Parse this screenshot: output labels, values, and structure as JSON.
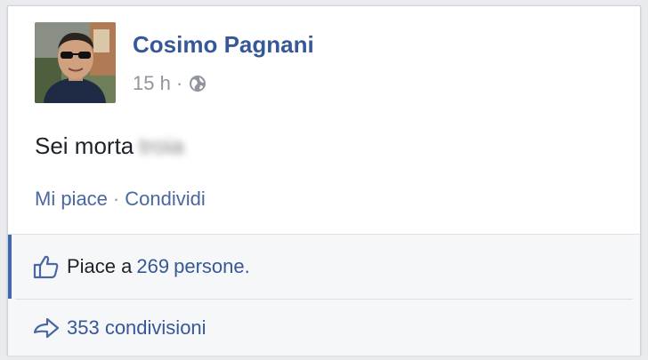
{
  "post": {
    "author": "Cosimo Pagnani",
    "time": "15 h",
    "meta_separator": "·",
    "privacy_icon": "globe-icon",
    "text": "Sei morta",
    "blurred_text": "troia"
  },
  "actions": {
    "like": "Mi piace",
    "separator": "·",
    "share": "Condividi"
  },
  "likes": {
    "icon": "thumbs-up-icon",
    "prefix": "Piace a",
    "count": "269",
    "suffix": "persone."
  },
  "shares": {
    "icon": "share-arrow-icon",
    "text": "353 condivisioni"
  },
  "colors": {
    "link_blue": "#365899",
    "accent_bar": "#4267b2",
    "meta_gray": "#90949c"
  }
}
